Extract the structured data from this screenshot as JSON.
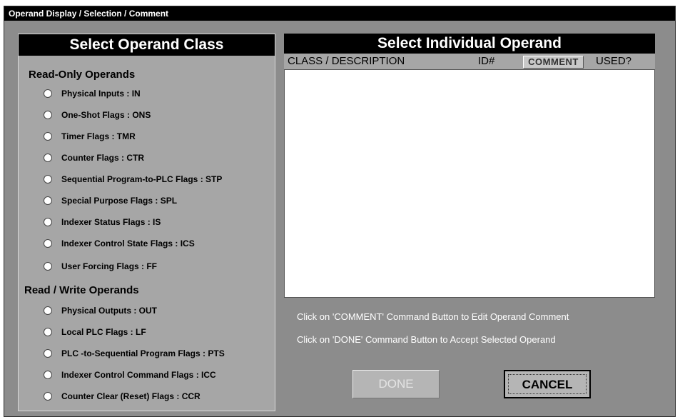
{
  "window": {
    "title": "Operand Display / Selection / Comment"
  },
  "left_panel": {
    "header": "Select Operand Class",
    "read_only_title": "Read-Only Operands",
    "read_only_options": [
      "Physical Inputs  :  IN",
      "One-Shot Flags  :  ONS",
      "Timer Flags  :  TMR",
      "Counter Flags  :  CTR",
      "Sequential Program-to-PLC Flags  :  STP",
      "Special Purpose Flags  :  SPL",
      "Indexer Status Flags  :  IS",
      "Indexer Control State Flags  :  ICS",
      "User Forcing Flags  :  FF"
    ],
    "read_write_title": "Read / Write Operands",
    "read_write_options": [
      "Physical Outputs  :  OUT",
      "Local PLC Flags  :  LF",
      "PLC -to-Sequential Program Flags  :  PTS",
      "Indexer Control Command Flags  :  ICC",
      "Counter Clear (Reset) Flags  :  CCR"
    ]
  },
  "right_panel": {
    "header": "Select Individual Operand",
    "columns": {
      "class_description": "CLASS / DESCRIPTION",
      "id": "ID#",
      "comment": "COMMENT",
      "used": "USED?"
    }
  },
  "hints": [
    "Click on 'COMMENT' Command Button to Edit Operand Comment",
    "Click on 'DONE' Command Button to Accept Selected Operand"
  ],
  "buttons": {
    "done": "DONE",
    "cancel": "CANCEL"
  },
  "colors": {
    "window_bg": "#8c8c8c",
    "panel_bg": "#a6a6a6",
    "header_bg": "#000000",
    "list_bg": "#ffffff"
  }
}
